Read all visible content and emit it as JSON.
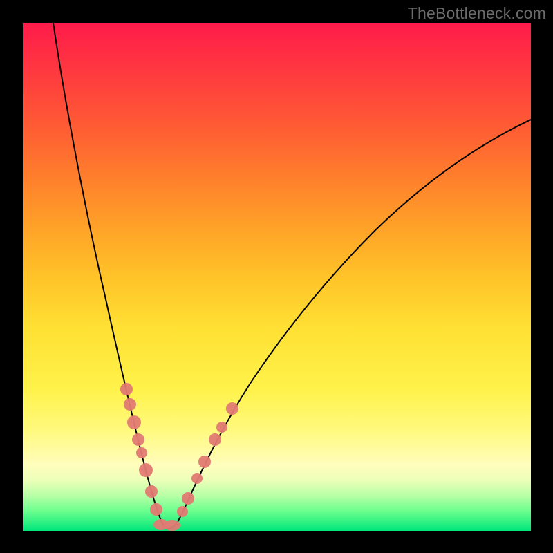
{
  "watermark": "TheBottleneck.com",
  "colors": {
    "frame": "#000000",
    "gradient_top": "#ff1b4a",
    "gradient_bottom": "#00e67a",
    "curve": "#000000",
    "marker": "#e27a73"
  },
  "chart_data": {
    "type": "line",
    "title": "",
    "xlabel": "",
    "ylabel": "",
    "xlim": [
      0,
      100
    ],
    "ylim": [
      0,
      100
    ],
    "grid": false,
    "legend": false,
    "series": [
      {
        "name": "left-curve",
        "x": [
          6,
          8,
          10,
          12,
          14,
          16,
          18,
          20,
          22,
          23,
          24,
          25,
          26,
          27
        ],
        "y": [
          100,
          88,
          75,
          62,
          50,
          39,
          29,
          20,
          12,
          8,
          5,
          3,
          1.5,
          0.5
        ]
      },
      {
        "name": "right-curve",
        "x": [
          27,
          29,
          32,
          36,
          40,
          45,
          50,
          56,
          62,
          70,
          78,
          86,
          94,
          100
        ],
        "y": [
          0.5,
          3,
          8,
          15,
          22,
          30,
          37,
          44,
          51,
          58,
          65,
          71,
          76,
          80
        ]
      }
    ],
    "markers": [
      {
        "series": "left-curve",
        "x": 19,
        "y": 25
      },
      {
        "series": "left-curve",
        "x": 20,
        "y": 20
      },
      {
        "series": "left-curve",
        "x": 21,
        "y": 16
      },
      {
        "series": "left-curve",
        "x": 22,
        "y": 12
      },
      {
        "series": "left-curve",
        "x": 22.5,
        "y": 10
      },
      {
        "series": "left-curve",
        "x": 23.5,
        "y": 7
      },
      {
        "series": "left-curve",
        "x": 24.5,
        "y": 4
      },
      {
        "series": "left-curve",
        "x": 25.5,
        "y": 2
      },
      {
        "series": "trough",
        "x": 26.5,
        "y": 0.5
      },
      {
        "series": "trough",
        "x": 28,
        "y": 0.5
      },
      {
        "series": "right-curve",
        "x": 30,
        "y": 5
      },
      {
        "series": "right-curve",
        "x": 31,
        "y": 7
      },
      {
        "series": "right-curve",
        "x": 33,
        "y": 12
      },
      {
        "series": "right-curve",
        "x": 35,
        "y": 16
      },
      {
        "series": "right-curve",
        "x": 37,
        "y": 20
      },
      {
        "series": "right-curve",
        "x": 38,
        "y": 22
      }
    ]
  }
}
